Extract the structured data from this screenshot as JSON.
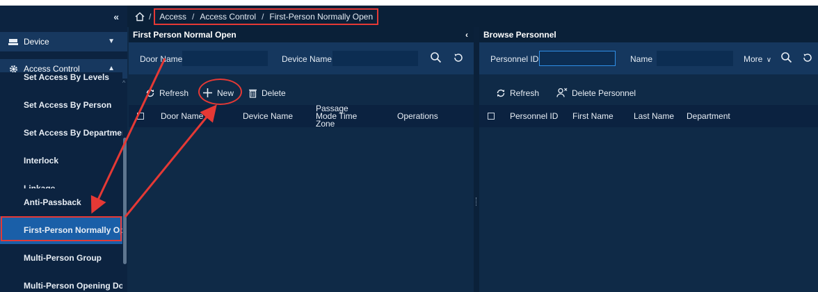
{
  "breadcrumb": {
    "items": [
      "Access",
      "Access Control",
      "First-Person Normally Open"
    ],
    "separator": "/"
  },
  "sidebar": {
    "groups": [
      {
        "label": "Device",
        "icon": "device-icon",
        "expanded": false
      },
      {
        "label": "Access Control",
        "icon": "gear-icon",
        "expanded": true
      }
    ],
    "items": [
      {
        "label": "Set Access By Levels"
      },
      {
        "label": "Set Access By Person"
      },
      {
        "label": "Set Access By Department"
      },
      {
        "label": "Interlock"
      },
      {
        "label": "Linkage"
      },
      {
        "label": "Anti-Passback"
      },
      {
        "label": "First-Person Normally Open",
        "active": true
      },
      {
        "label": "Multi-Person Group"
      },
      {
        "label": "Multi-Person Opening Door"
      }
    ]
  },
  "left_panel": {
    "title": "First Person Normal Open",
    "search": {
      "door_name_label": "Door Name",
      "device_name_label": "Device Name",
      "door_name_value": "",
      "device_name_value": ""
    },
    "toolbar": {
      "refresh_label": "Refresh",
      "new_label": "New",
      "delete_label": "Delete"
    },
    "columns": [
      "Door Name",
      "Device Name",
      "Passage Mode Time Zone",
      "Operations"
    ]
  },
  "right_panel": {
    "title": "Browse Personnel",
    "search": {
      "personnel_id_label": "Personnel ID",
      "name_label": "Name",
      "more_label": "More",
      "personnel_id_value": "",
      "name_value": ""
    },
    "toolbar": {
      "refresh_label": "Refresh",
      "delete_personnel_label": "Delete Personnel"
    },
    "columns": [
      "Personnel ID",
      "First Name",
      "Last Name",
      "Department"
    ]
  },
  "colors": {
    "annotation": "#e53935",
    "active_item": "#1a5fa8",
    "panel_bg": "#0f2a47",
    "search_bg": "#15375e"
  }
}
